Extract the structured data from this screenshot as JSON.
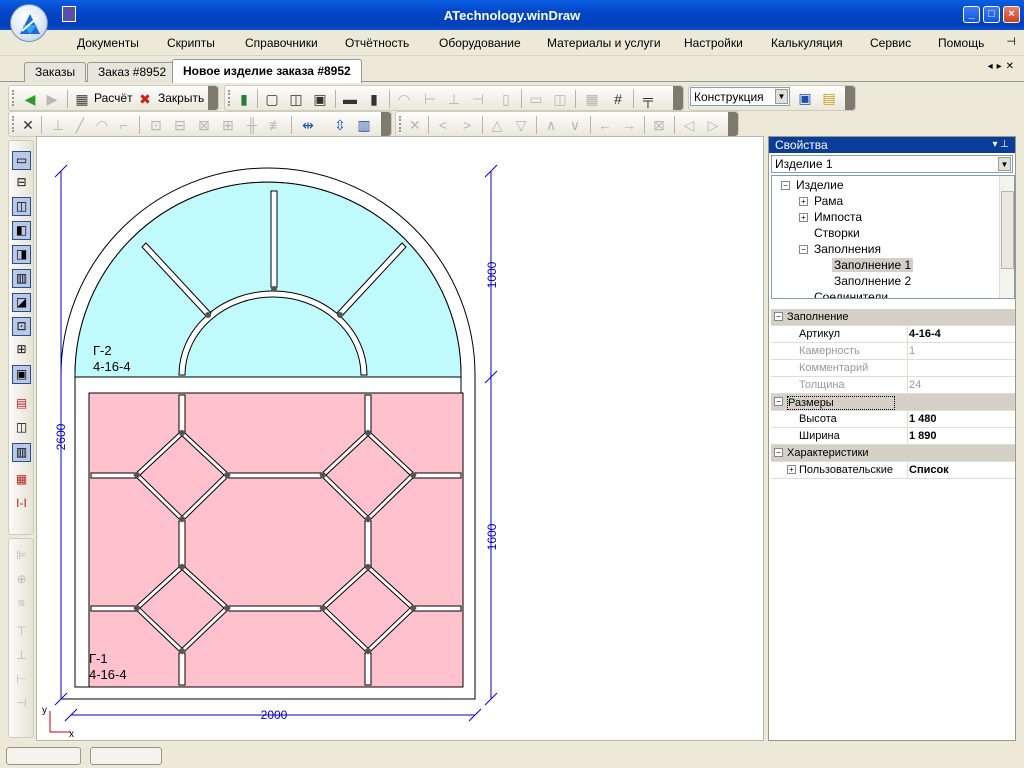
{
  "window": {
    "title": "ATechnology.winDraw"
  },
  "menu": [
    "Документы",
    "Скрипты",
    "Справочники",
    "Отчётность",
    "Оборудование",
    "Материалы и услуги",
    "Настройки",
    "Калькуляция",
    "Сервис",
    "Помощь"
  ],
  "tabs": [
    {
      "label": "Заказы"
    },
    {
      "label": "Заказ #8952"
    },
    {
      "label": "Новое изделие заказа #8952"
    }
  ],
  "toolbar": {
    "calc_label": "Расчёт",
    "close_label": "Закрыть",
    "mode_value": "Конструкция"
  },
  "drawing": {
    "top_glass_code": "Г-2",
    "top_glass_formula": "4-16-4",
    "bottom_glass_code": "Г-1",
    "bottom_glass_formula": "4-16-4",
    "dim_total_height": "2600",
    "dim_top_height": "1000",
    "dim_bottom_height": "1600",
    "dim_width": "2000",
    "axis_x": "x",
    "axis_y": "y"
  },
  "properties": {
    "title": "Свойства",
    "object": "Изделие 1",
    "tree": {
      "root": "Изделие",
      "rama": "Рама",
      "imposta": "Импоста",
      "stvorki": "Створки",
      "zapolneniya": "Заполнения",
      "fill1": "Заполнение 1",
      "fill2": "Заполнение 2",
      "soed": "Соединители"
    },
    "grid": {
      "cat_fill": "Заполнение",
      "articul_name": "Артикул",
      "articul_val": "4-16-4",
      "kamer_name": "Камерность",
      "kamer_val": "1",
      "comment_name": "Комментарий",
      "comment_val": "",
      "thick_name": "Толщина",
      "thick_val": "24",
      "cat_size": "Размеры",
      "height_name": "Высота",
      "height_val": "1 480",
      "width_name": "Ширина",
      "width_val": "1 890",
      "cat_char": "Характеристики",
      "user_name": "Пользовательские",
      "user_val": "Список"
    }
  },
  "colors": {
    "upper_glass": "#c0fafc",
    "lower_glass": "#ffc2cc",
    "dimension": "#0000c8",
    "title_bar": "#0346c9"
  }
}
